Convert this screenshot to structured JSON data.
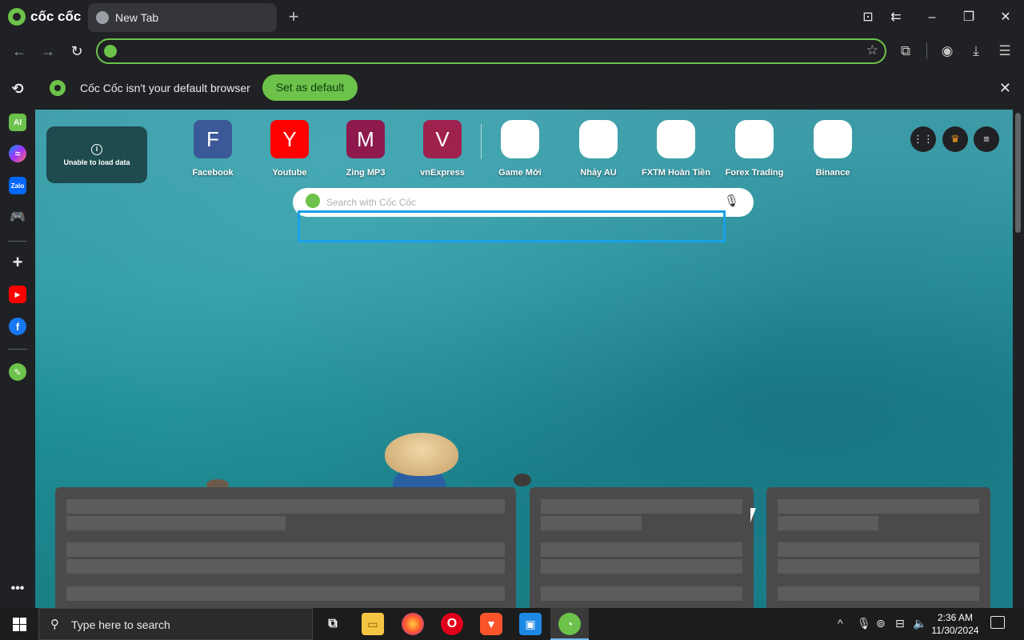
{
  "browser": {
    "brand": "cốc cốc",
    "tab_title": "New Tab"
  },
  "omnibox": {
    "value": "",
    "placeholder": ""
  },
  "infobar": {
    "message": "Cốc Cốc isn't your default browser",
    "button": "Set as default"
  },
  "newtab": {
    "unable_message": "Unable to load data",
    "shortcuts": [
      {
        "letter": "F",
        "label": "Facebook",
        "color": "#3b5998"
      },
      {
        "letter": "Y",
        "label": "Youtube",
        "color": "#ff0000"
      },
      {
        "letter": "M",
        "label": "Zing MP3",
        "color": "#8e1a4d"
      },
      {
        "letter": "V",
        "label": "vnExpress",
        "color": "#9f224e"
      },
      {
        "letter": "",
        "label": "Game Mới",
        "color": "#ffffff"
      },
      {
        "letter": "",
        "label": "Nhảy AU",
        "color": "#ffffff"
      },
      {
        "letter": "",
        "label": "FXTM Hoàn Tiền",
        "color": "#ffffff"
      },
      {
        "letter": "",
        "label": "Forex Trading",
        "color": "#ffffff"
      },
      {
        "letter": "",
        "label": "Binance",
        "color": "#ffffff"
      }
    ],
    "search_placeholder": "Search with Cốc Cốc"
  },
  "taskbar": {
    "search_text": "Type here to search",
    "time": "2:36 AM",
    "date": "11/30/2024"
  },
  "colors": {
    "accent": "#6cc24a",
    "focus": "#1aa1e8"
  }
}
